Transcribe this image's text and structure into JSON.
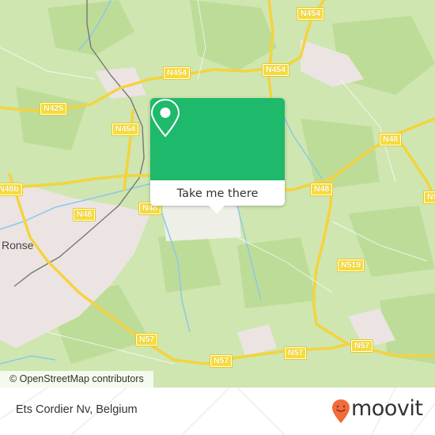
{
  "map": {
    "attribution": "© OpenStreetMap contributors",
    "place_labels": [
      {
        "id": "ronse",
        "text": "Ronse"
      }
    ],
    "road_labels": [
      {
        "id": "n454-top-right",
        "text": "N454"
      },
      {
        "id": "n454-center",
        "text": "N454"
      },
      {
        "id": "n454-right",
        "text": "N454"
      },
      {
        "id": "n425",
        "text": "N425"
      },
      {
        "id": "n454-left",
        "text": "N454"
      },
      {
        "id": "n48b",
        "text": "N48b"
      },
      {
        "id": "n48-left",
        "text": "N48"
      },
      {
        "id": "n48-center",
        "text": "N48"
      },
      {
        "id": "n48-right",
        "text": "N48"
      },
      {
        "id": "n48-far-right",
        "text": "N48"
      },
      {
        "id": "n5-edge",
        "text": "N5"
      },
      {
        "id": "n519",
        "text": "N519"
      },
      {
        "id": "n57-left",
        "text": "N57"
      },
      {
        "id": "n57-a",
        "text": "N57"
      },
      {
        "id": "n57-b",
        "text": "N57"
      },
      {
        "id": "n57-c",
        "text": "N57"
      }
    ],
    "colors": {
      "land": "#cfe6b0",
      "forest": "#bddc98",
      "urban": "#ece4e2",
      "road": "#f7dc3a",
      "water": "#8cc8e8",
      "rail": "#777777"
    }
  },
  "popup": {
    "icon": "map-pin-icon",
    "action_label": "Take me there",
    "accent": "#1fb96b"
  },
  "footer": {
    "location": "Ets Cordier Nv, Belgium",
    "brand": "moovit",
    "brand_color": "#f26b3a"
  }
}
